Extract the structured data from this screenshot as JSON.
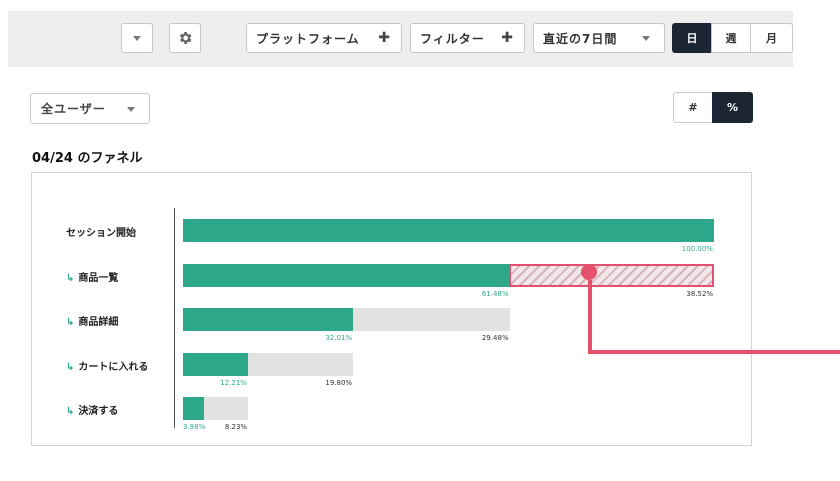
{
  "toolbar": {
    "platform_label": "プラットフォーム",
    "filter_label": "フィルター",
    "plus_glyph": "✚",
    "date_range": "直近の7日間",
    "granularity": [
      "日",
      "週",
      "月"
    ],
    "active_granularity": "日"
  },
  "segment_select": {
    "value": "全ユーザー"
  },
  "display_mode": {
    "options": [
      "#",
      "%"
    ],
    "active": "%"
  },
  "funnel_title": "04/24 のファネル",
  "chart_data": {
    "type": "bar",
    "orientation": "horizontal",
    "categories": [
      "セッション開始",
      "商品一覧",
      "商品詳細",
      "カートに入れる",
      "決済する"
    ],
    "step_arrow": "↳",
    "values": [
      100.0,
      61.48,
      32.01,
      12.21,
      3.98
    ],
    "drop_off": [
      null,
      38.52,
      29.48,
      19.8,
      8.23
    ],
    "value_labels": [
      "100.00%",
      "61.48%",
      "32.01%",
      "12.21%",
      "3.98%"
    ],
    "drop_labels": [
      "",
      "38.52%",
      "29.48%",
      "19.80%",
      "8.23%"
    ],
    "highlighted_drop_step": 1,
    "colors": {
      "converted": "#2ea88b",
      "dropped": "#e2e2e0",
      "highlight": "#e5506b"
    }
  }
}
